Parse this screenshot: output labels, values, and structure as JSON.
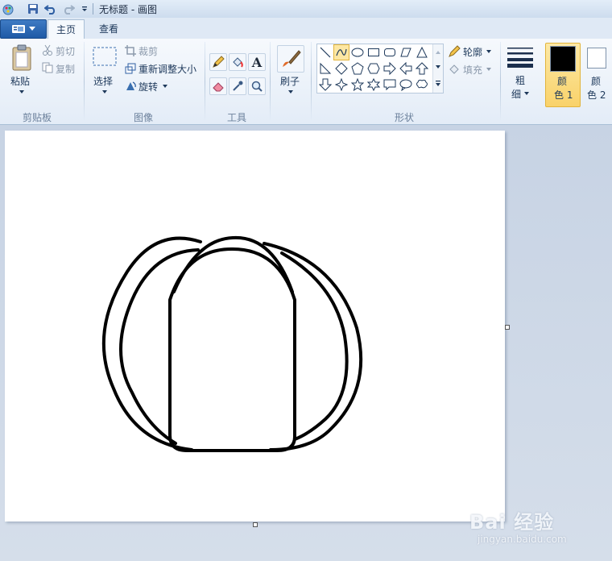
{
  "window": {
    "title": "无标题 - 画图"
  },
  "tabs": {
    "home": "主页",
    "view": "查看"
  },
  "clipboard": {
    "paste": "粘贴",
    "cut": "剪切",
    "copy": "复制",
    "label": "剪贴板"
  },
  "image": {
    "select": "选择",
    "crop": "裁剪",
    "resize": "重新调整大小",
    "rotate": "旋转",
    "label": "图像"
  },
  "tools": {
    "label": "工具",
    "text_glyph": "A"
  },
  "brushes": {
    "label": "刷子"
  },
  "shapes": {
    "outline": "轮廓",
    "fill": "填充",
    "label": "形状"
  },
  "size": {
    "label_line1": "粗",
    "label_line2": "细"
  },
  "colors": {
    "color1_line1": "颜",
    "color1_line2": "色 1",
    "color2_line1": "颜",
    "color2_line2": "色 2",
    "color1_value": "#000000",
    "color2_value": "#ffffff"
  },
  "watermark": {
    "brand": "Bai 经验",
    "url": "jingyan.baidu.com"
  }
}
